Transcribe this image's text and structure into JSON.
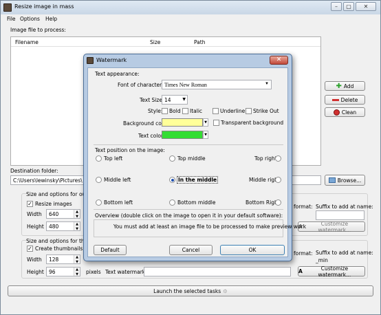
{
  "app": {
    "title": "Resize image in mass"
  },
  "menu": [
    "File",
    "Options",
    "Help"
  ],
  "image_section": {
    "label": "Image file to process:",
    "columns": [
      "Filename",
      "Size",
      "Path"
    ]
  },
  "buttons": {
    "add": "Add",
    "delete": "Delete",
    "clean": "Clean",
    "browse": "Browse..."
  },
  "destination": {
    "label": "Destination folder:",
    "value": "C:\\Users\\lewinsky\\Pictures\\"
  },
  "output": {
    "options_label": "Size and options for outpu",
    "resize_label": "Resize images",
    "width_label": "Width",
    "width_value": "640",
    "height_label": "Height",
    "height_value": "480",
    "format_label": "format:",
    "suffix_label": "Suffix to add at name:",
    "suffix_value": "",
    "customize_watermark": "Customize watermark..."
  },
  "thumb": {
    "options_label": "Size and options for thumb",
    "create_label": "Create thumbnails",
    "width_label": "Width",
    "width_value": "128",
    "height_label": "Height",
    "height_value": "96",
    "pixels_label": "pixels",
    "text_watermark_label": "Text watermark:",
    "text_watermark_value": "",
    "format_label": "format:",
    "suffix_label": "Suffix to add at name:",
    "suffix_value": "_min",
    "customize_watermark": "Customize watermark..."
  },
  "launch": {
    "label": "Launch the selected tasks"
  },
  "dialog": {
    "title": "Watermark",
    "close": "✕",
    "text_appearance": "Text appearance:",
    "font_label": "Font of characters:",
    "font_value": "Times New Roman",
    "text_size_label": "Text Size:",
    "text_size_value": "14",
    "style_label": "Style:",
    "bold": "Bold",
    "italic": "Italic",
    "underline": "Underline",
    "strikeout": "Strike Out",
    "bg_color_label": "Background color:",
    "transparent_bg": "Transparent background",
    "text_color_label": "Text color:",
    "position_label": "Text position on the image:",
    "positions": {
      "tl": "Top left",
      "tm": "Top middle",
      "tr": "Top right",
      "ml": "Middle left",
      "mm": "In the middle",
      "mr": "Middle right",
      "bl": "Bottom left",
      "bm": "Bottom middle",
      "br": "Bottom Right"
    },
    "overview_label": "Overview (double click on the image to open it in your default software):",
    "overview_msg": "You must add at least an image file to be processed to make preview work",
    "default_btn": "Default",
    "cancel_btn": "Cancel",
    "ok_btn": "OK",
    "colors": {
      "background": "#ffff99",
      "text": "#33dd33"
    }
  }
}
